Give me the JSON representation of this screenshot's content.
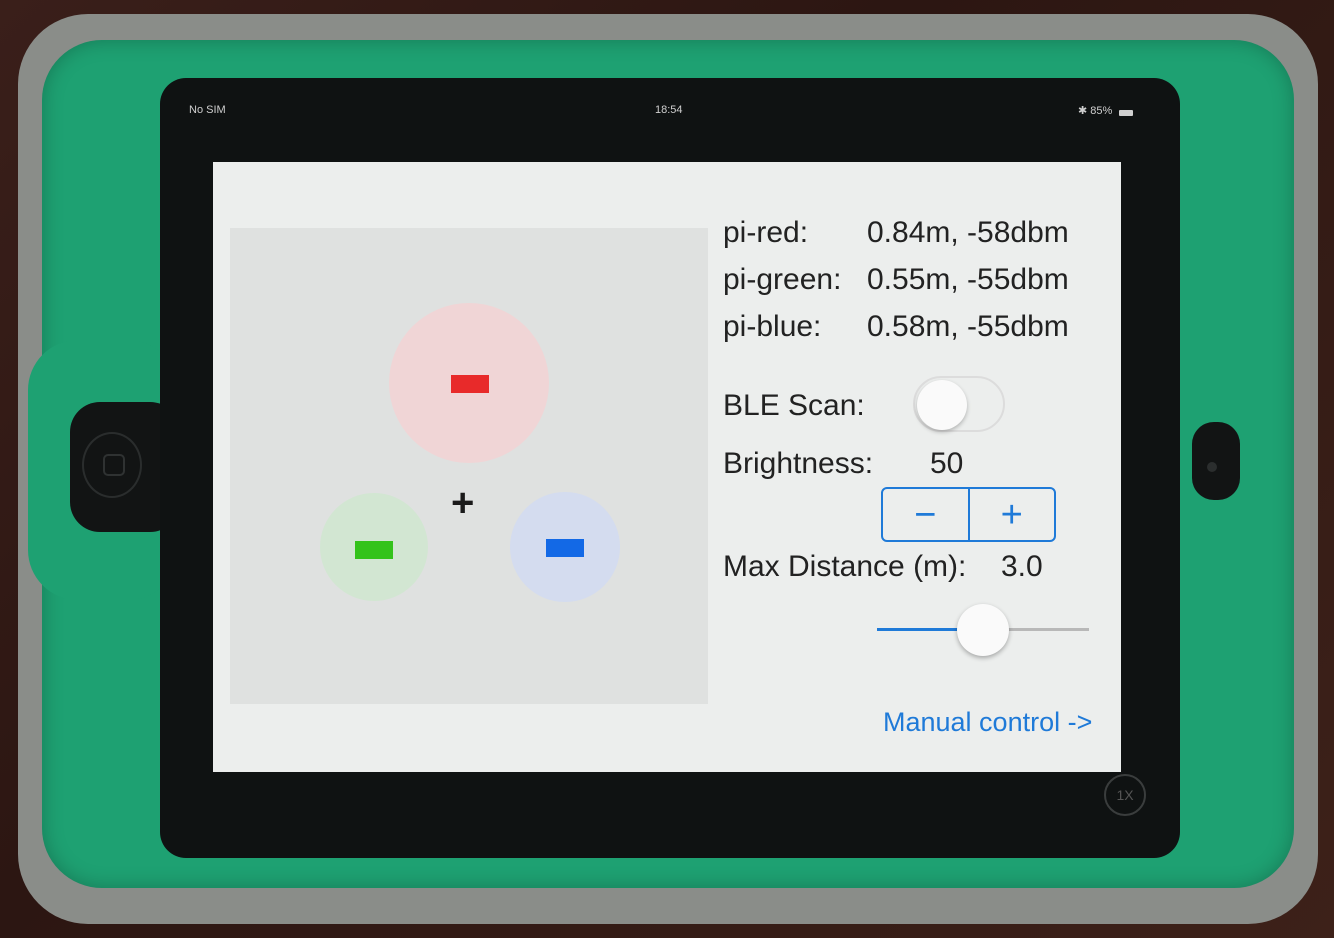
{
  "status_bar": {
    "carrier": "No SIM",
    "time": "18:54",
    "battery": "85%"
  },
  "beacons": [
    {
      "label": "pi-red:",
      "value": "0.84m, -58dbm",
      "color": "#e82a2a"
    },
    {
      "label": "pi-green:",
      "value": "0.55m, -55dbm",
      "color": "#33c31a"
    },
    {
      "label": "pi-blue:",
      "value": "0.58m, -55dbm",
      "color": "#1369e6"
    }
  ],
  "ble_scan": {
    "label": "BLE Scan:",
    "enabled": false
  },
  "brightness": {
    "label": "Brightness:",
    "value": "50",
    "minus": "−",
    "plus": "+"
  },
  "max_distance": {
    "label": "Max Distance (m):",
    "value": "3.0",
    "slider_fraction": 0.5
  },
  "center_marker": "+",
  "manual_link": "Manual control ->",
  "zoom_badge": "1X",
  "accent_color": "#1f7ad8"
}
